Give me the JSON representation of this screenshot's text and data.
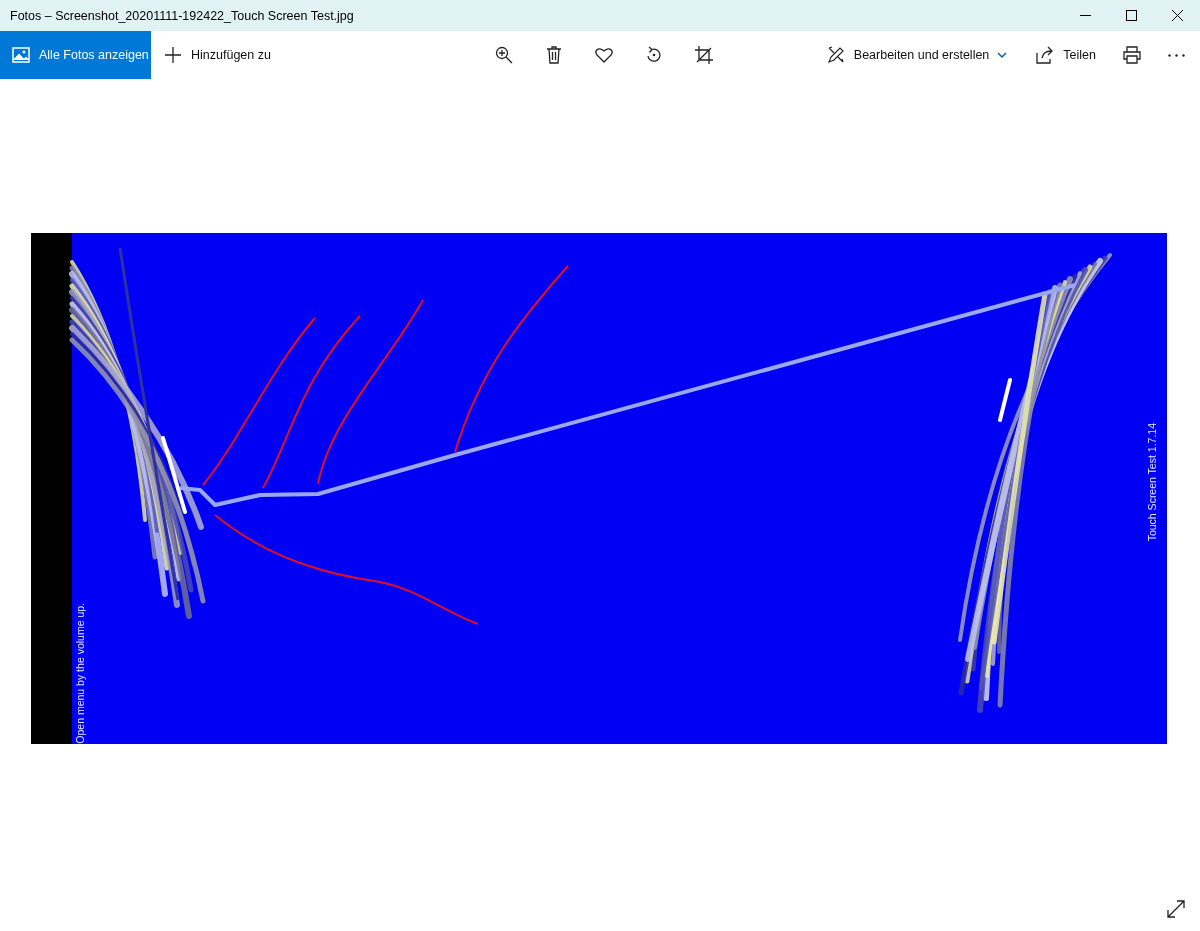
{
  "window": {
    "title": "Fotos – Screenshot_20201111-192422_Touch Screen Test.jpg"
  },
  "toolbar": {
    "left": [
      {
        "kind": "primary",
        "label": "Alle Fotos anzeigen"
      },
      {
        "kind": "text",
        "label": "Hinzufügen zu"
      }
    ],
    "center": [
      {
        "kind": "icon"
      },
      {
        "kind": "icon"
      },
      {
        "kind": "icon"
      },
      {
        "kind": "icon"
      },
      {
        "kind": "icon"
      }
    ],
    "right": [
      {
        "kind": "dropdown",
        "label": "Bearbeiten und erstellen"
      },
      {
        "kind": "text",
        "label": "Teilen"
      },
      {
        "kind": "icon"
      },
      {
        "kind": "icon"
      }
    ]
  },
  "photo": {
    "left_caption": "Open menu by the volume up.",
    "right_caption": "Touch Screen Test 1.7.14"
  }
}
